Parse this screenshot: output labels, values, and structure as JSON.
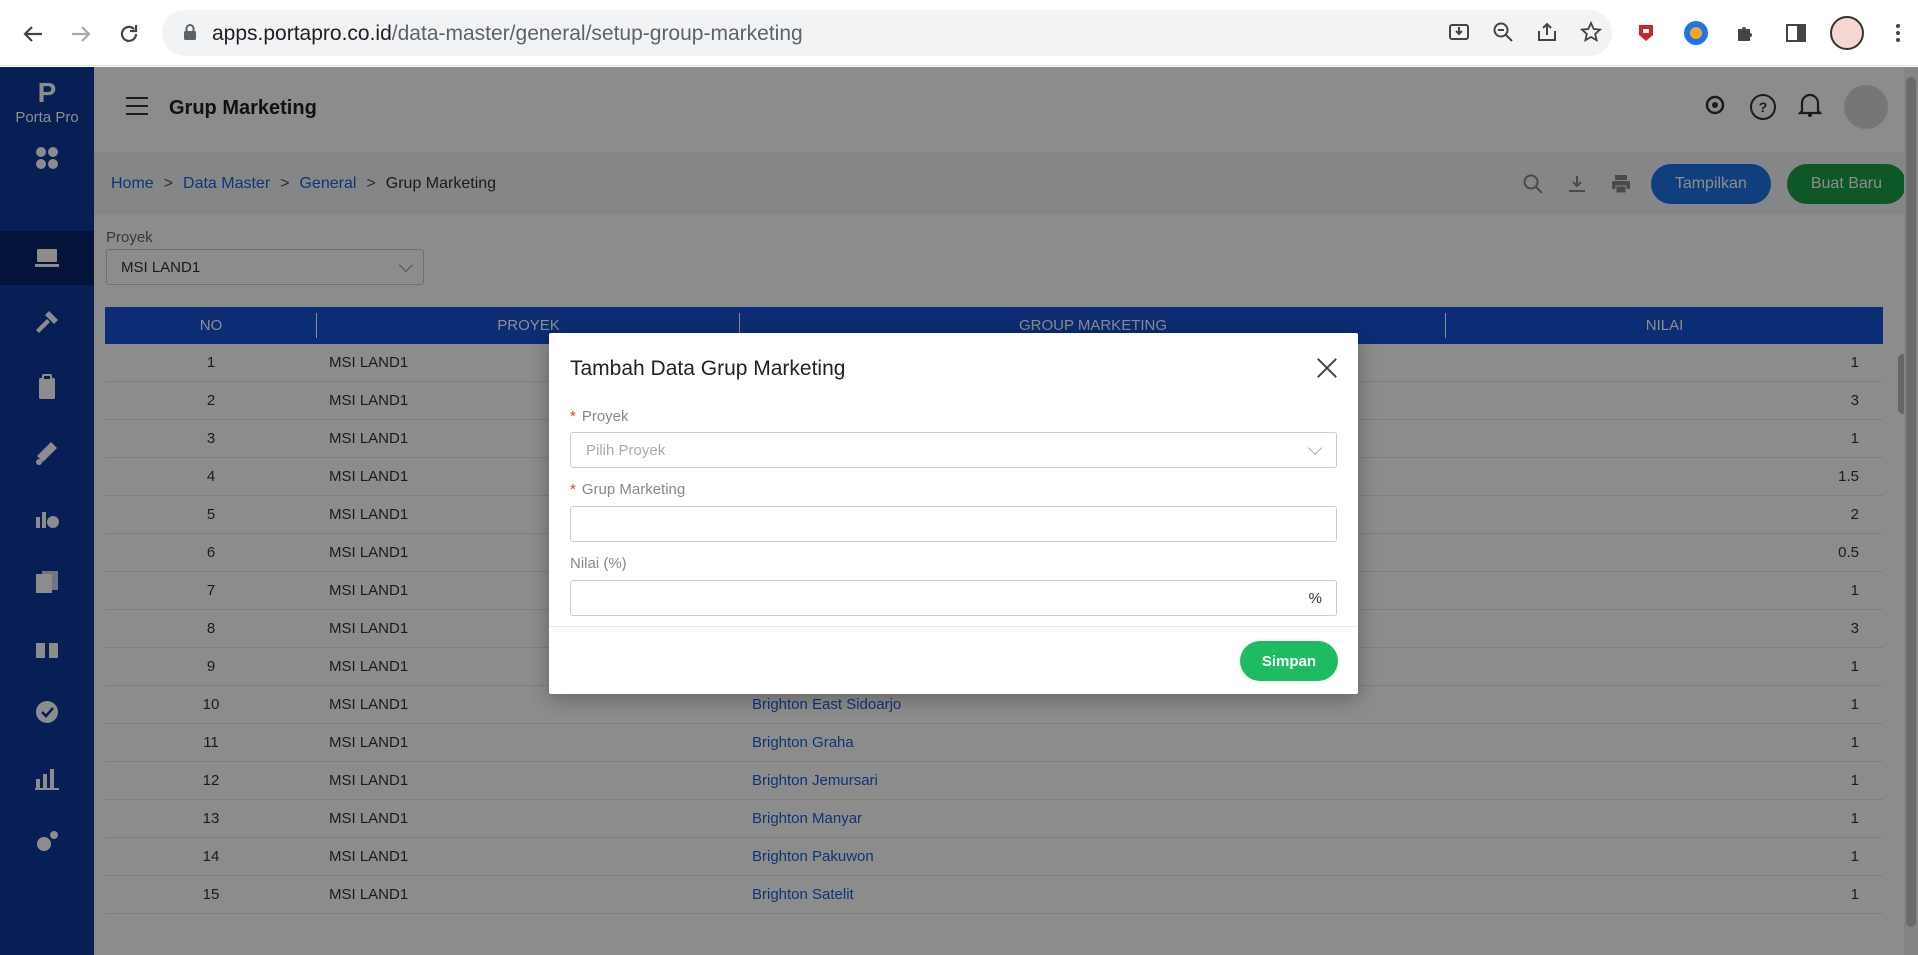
{
  "browser": {
    "url_host": "apps.portapro.co.id",
    "url_path": "/data-master/general/setup-group-marketing"
  },
  "sidebar": {
    "logo_mark": "P",
    "logo_text": "Porta Pro",
    "items": [
      {
        "icon": "dashboard-icon"
      },
      {
        "icon": "data-master-icon",
        "active": true
      },
      {
        "icon": "tools-icon"
      },
      {
        "icon": "clipboard-icon"
      },
      {
        "icon": "marketing-icon"
      },
      {
        "icon": "finance-icon"
      },
      {
        "icon": "report-icon"
      },
      {
        "icon": "gift-icon"
      },
      {
        "icon": "verified-icon"
      },
      {
        "icon": "chart-icon"
      },
      {
        "icon": "settings-icon"
      }
    ]
  },
  "header": {
    "title": "Grup Marketing"
  },
  "breadcrumb": {
    "home": "Home",
    "data_master": "Data Master",
    "general": "General",
    "current": "Grup Marketing",
    "separator": ">"
  },
  "toolbar": {
    "show_label": "Tampilkan",
    "new_label": "Buat Baru"
  },
  "filter": {
    "label": "Proyek",
    "value": "MSI LAND1"
  },
  "table": {
    "columns": [
      "NO",
      "PROYEK",
      "GROUP MARKETING",
      "NILAI"
    ],
    "rows": [
      {
        "no": "1",
        "proyek": "MSI LAND1",
        "group": "",
        "nilai": "1"
      },
      {
        "no": "2",
        "proyek": "MSI LAND1",
        "group": "",
        "nilai": "3"
      },
      {
        "no": "3",
        "proyek": "MSI LAND1",
        "group": "",
        "nilai": "1"
      },
      {
        "no": "4",
        "proyek": "MSI LAND1",
        "group": "",
        "nilai": "1.5"
      },
      {
        "no": "5",
        "proyek": "MSI LAND1",
        "group": "",
        "nilai": "2"
      },
      {
        "no": "6",
        "proyek": "MSI LAND1",
        "group": "",
        "nilai": "0.5"
      },
      {
        "no": "7",
        "proyek": "MSI LAND1",
        "group": "",
        "nilai": "1"
      },
      {
        "no": "8",
        "proyek": "MSI LAND1",
        "group": "",
        "nilai": "3"
      },
      {
        "no": "9",
        "proyek": "MSI LAND1",
        "group": "",
        "nilai": "1"
      },
      {
        "no": "10",
        "proyek": "MSI LAND1",
        "group": "Brighton East Sidoarjo",
        "nilai": "1"
      },
      {
        "no": "11",
        "proyek": "MSI LAND1",
        "group": "Brighton Graha",
        "nilai": "1"
      },
      {
        "no": "12",
        "proyek": "MSI LAND1",
        "group": "Brighton Jemursari",
        "nilai": "1"
      },
      {
        "no": "13",
        "proyek": "MSI LAND1",
        "group": "Brighton Manyar",
        "nilai": "1"
      },
      {
        "no": "14",
        "proyek": "MSI LAND1",
        "group": "Brighton Pakuwon",
        "nilai": "1"
      },
      {
        "no": "15",
        "proyek": "MSI LAND1",
        "group": "Brighton Satelit",
        "nilai": "1"
      }
    ]
  },
  "modal": {
    "title": "Tambah Data Grup Marketing",
    "proyek_label": "Proyek",
    "proyek_placeholder": "Pilih Proyek",
    "grup_label": "Grup Marketing",
    "grup_value": "",
    "nilai_label": "Nilai (%)",
    "nilai_value": "",
    "nilai_suffix": "%",
    "required_mark": "*",
    "save_label": "Simpan"
  },
  "colors": {
    "sidebar": "#0d3a9c",
    "table_header": "#1553d6",
    "primary_button": "#1e73e6",
    "new_button": "#1a9e47",
    "save_button": "#1dbc60",
    "link": "#1e5fd6"
  }
}
